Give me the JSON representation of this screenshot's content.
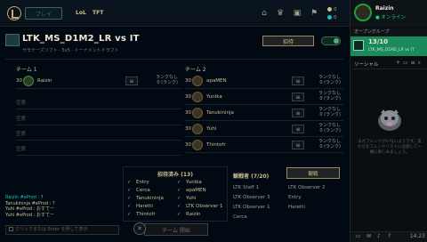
{
  "nav": {
    "play_label": "プレイ",
    "games": [
      "LoL",
      "TFT"
    ],
    "currency": [
      {
        "value": "0",
        "color": "#cdbe91"
      },
      {
        "value": "0",
        "color": "#0ac8b9"
      }
    ]
  },
  "lobby": {
    "title": "LTK_MS_D1M2_LR vs IT",
    "subtitle": "サモナーズリフト · 5v5 · トーナメントドラフト",
    "invite_label": "招待"
  },
  "team1": {
    "label": "チーム 1",
    "players": [
      {
        "name": "Raizin",
        "level": "30",
        "role": "≡",
        "rank": "ランクなし\n0 (ランク)"
      },
      {
        "empty": "空席"
      },
      {
        "empty": "空席"
      },
      {
        "empty": "空席"
      },
      {
        "empty": "空席"
      }
    ]
  },
  "team2": {
    "label": "チーム 2",
    "players": [
      {
        "name": "apaMEN",
        "level": "30",
        "role": "≡",
        "rank": "ランクなし\n0 (ランク)"
      },
      {
        "name": "Yunika",
        "level": "30",
        "role": "≡",
        "rank": "ランクなし\n0 (ランク)"
      },
      {
        "name": "Tanukininja",
        "level": "30",
        "role": "≡",
        "rank": "ランクなし\n0 (ランク)"
      },
      {
        "name": "Yuhi",
        "level": "30",
        "role": "≡",
        "rank": "ランクなし\n0 (ランク)"
      },
      {
        "name": "Thintofr",
        "level": "30",
        "role": "≡",
        "rank": "ランクなし\n0 (ランク)"
      }
    ]
  },
  "chat": {
    "lines": [
      {
        "user": "Raizin #eProd :",
        "text": "?"
      },
      {
        "user": "Tanukininja #eProd :",
        "text": "?"
      },
      {
        "user": "Yuhi #eProd :",
        "text": "おすてー"
      },
      {
        "user": "Yuhi #eProd :",
        "text": "おすてー"
      }
    ],
    "placeholder": "クリックまたは Enter を押して表示"
  },
  "invited": {
    "title": "招待済み (13)",
    "left": [
      "Entry",
      "Cerca",
      "Tanukininja",
      "Haretti",
      "Thintofr"
    ],
    "right": [
      "Yunika",
      "apaMEN",
      "Yuhi",
      "LTK Observer 1",
      "Raizin"
    ]
  },
  "observers": {
    "title": "観戦者 (7/20)",
    "button": "観戦",
    "left": [
      "LTK Staff 1",
      "LTK Observer 3",
      "LTK Observer 1",
      "Cerca"
    ],
    "right": [
      "LTK Observer 2",
      "Entry",
      "Haretti"
    ]
  },
  "cancel_label": "チーム 開始",
  "social": {
    "me": {
      "name": "Raizin",
      "status": "● オンライン"
    },
    "group_header": "オープングループ",
    "group_count": "13/10",
    "group_sub": "LTK_MS_D1M2_LR vs IT",
    "label": "ソーシャル",
    "empty": "まだフレンドがいないようです。友だちをフレンドリストに追加してー緒に楽しみましょう。",
    "version": "14.23"
  }
}
